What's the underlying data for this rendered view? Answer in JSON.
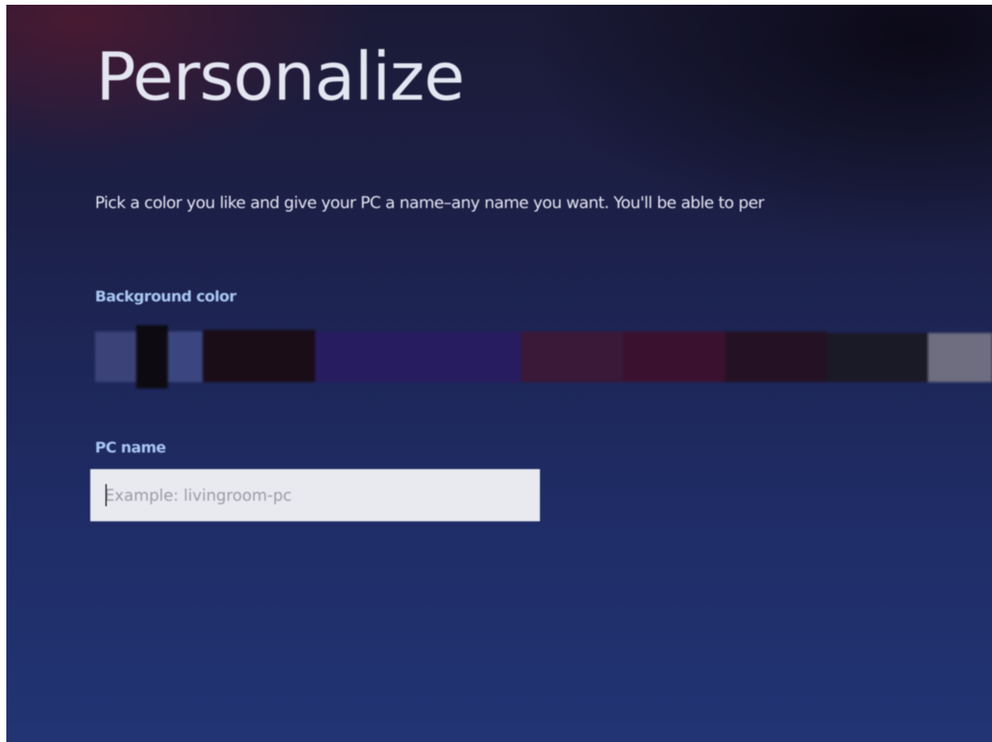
{
  "screen": {
    "title": "Personalize",
    "description": "Pick a color you like and give your PC a name–any name you want. You'll be able to per"
  },
  "background_color": {
    "label": "Background color",
    "swatches": [
      {
        "color": "#3a4278"
      },
      {
        "color": "#0e0a12"
      },
      {
        "color": "#3b4680"
      },
      {
        "color": "#1a0d18"
      },
      {
        "color": "#281c60"
      },
      {
        "color": "#3a1838"
      },
      {
        "color": "#3a1230"
      },
      {
        "color": "#241224"
      },
      {
        "color": "#1a1a26"
      },
      {
        "color": "#6e6e80"
      }
    ]
  },
  "pc_name": {
    "label": "PC name",
    "placeholder": "Example: livingroom-pc",
    "value": ""
  }
}
